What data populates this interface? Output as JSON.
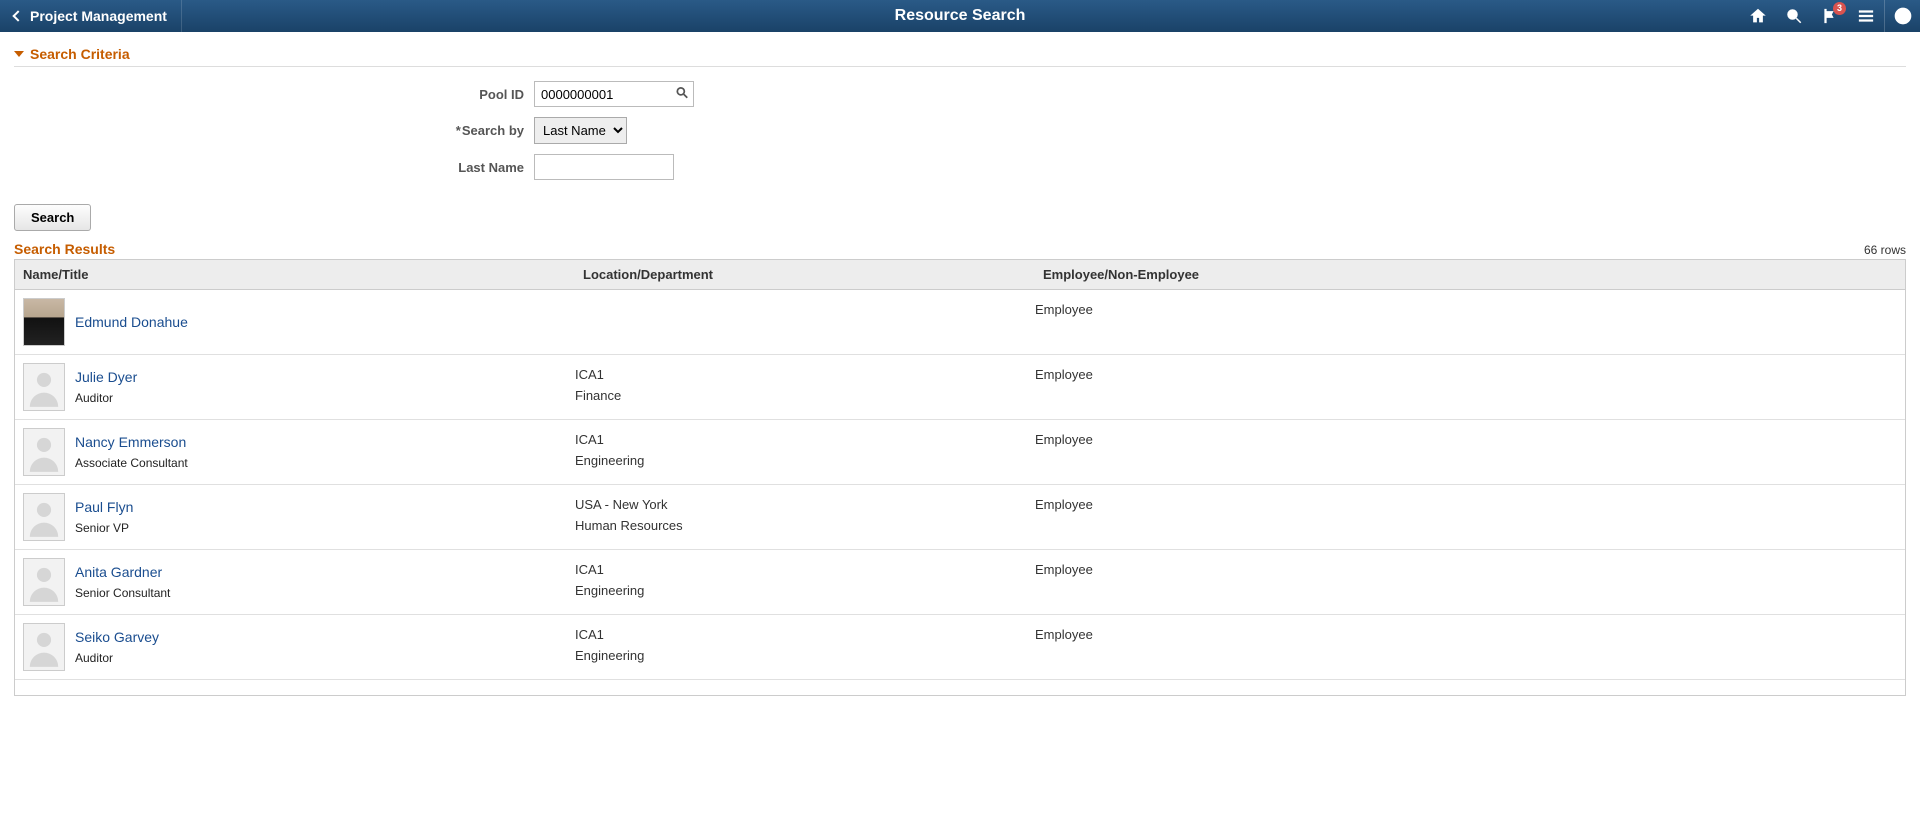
{
  "header": {
    "back_label": "Project Management",
    "title": "Resource Search",
    "notification_count": "3"
  },
  "criteria": {
    "section_title": "Search Criteria",
    "pool_id_label": "Pool ID",
    "pool_id_value": "0000000001",
    "search_by_label": "Search by",
    "search_by_value": "Last Name",
    "last_name_label": "Last Name",
    "last_name_value": "",
    "search_button": "Search"
  },
  "results": {
    "title": "Search Results",
    "row_count": "66 rows",
    "columns": {
      "name": "Name/Title",
      "location": "Location/Department",
      "employee": "Employee/Non-Employee"
    },
    "rows": [
      {
        "name": "Edmund Donahue",
        "title": "",
        "location": "",
        "department": "",
        "type": "Employee",
        "has_photo": true
      },
      {
        "name": "Julie Dyer",
        "title": "Auditor",
        "location": "ICA1",
        "department": "Finance",
        "type": "Employee",
        "has_photo": false
      },
      {
        "name": "Nancy Emmerson",
        "title": "Associate Consultant",
        "location": "ICA1",
        "department": "Engineering",
        "type": "Employee",
        "has_photo": false
      },
      {
        "name": "Paul Flyn",
        "title": "Senior VP",
        "location": "USA - New York",
        "department": "Human Resources",
        "type": "Employee",
        "has_photo": false
      },
      {
        "name": "Anita Gardner",
        "title": "Senior Consultant",
        "location": "ICA1",
        "department": "Engineering",
        "type": "Employee",
        "has_photo": false
      },
      {
        "name": "Seiko Garvey",
        "title": "Auditor",
        "location": "ICA1",
        "department": "Engineering",
        "type": "Employee",
        "has_photo": false
      }
    ]
  }
}
